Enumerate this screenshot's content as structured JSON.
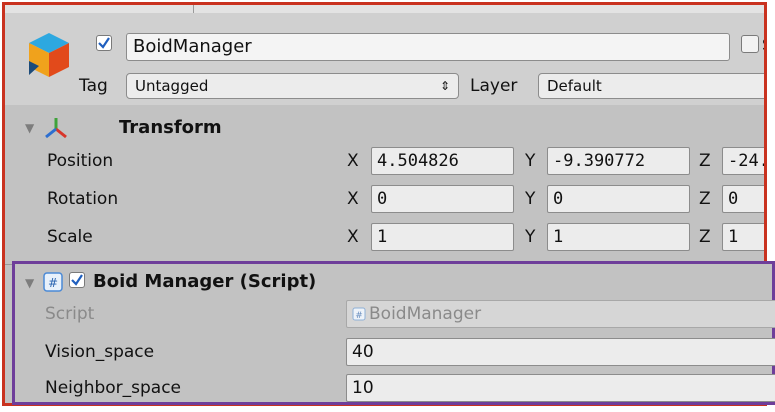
{
  "header": {
    "object_name": "BoidManager",
    "active_checked": true,
    "static_label": "S",
    "tag_label": "Tag",
    "tag_value": "Untagged",
    "layer_label": "Layer",
    "layer_value": "Default",
    "dropdown_arrow": "⇕"
  },
  "transform": {
    "title": "Transform",
    "rows": [
      {
        "label": "Position",
        "x": "4.504826",
        "y": "-9.390772",
        "z": "-24."
      },
      {
        "label": "Rotation",
        "x": "0",
        "y": "0",
        "z": "0"
      },
      {
        "label": "Scale",
        "x": "1",
        "y": "1",
        "z": "1"
      }
    ],
    "axis_x": "X",
    "axis_y": "Y",
    "axis_z": "Z"
  },
  "script_component": {
    "title": "Boid Manager (Script)",
    "enabled": true,
    "script_label": "Script",
    "script_value": "BoidManager",
    "fields": [
      {
        "label": "Vision_space",
        "value": "40"
      },
      {
        "label": "Neighbor_space",
        "value": "10"
      }
    ]
  },
  "colors": {
    "outer_highlight": "#c9321f",
    "script_highlight": "#6e3e9a",
    "panel_bg": "#c2c2c2"
  }
}
